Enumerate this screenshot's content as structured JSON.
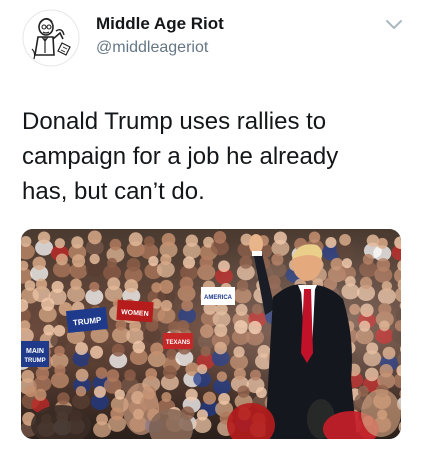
{
  "account": {
    "display_name": "Middle Age Riot",
    "handle": "@middleageriot"
  },
  "tweet": {
    "text_lines": [
      "Donald Trump uses rallies to",
      "campaign for a job he already",
      "has, but can’t do."
    ]
  },
  "media": {
    "signs": [
      "TRUMP",
      "WOMEN",
      "MAIN",
      "TRUMP",
      "TEXANS",
      "AMERICA"
    ]
  },
  "colors": {
    "text": "#14171a",
    "secondary": "#657786",
    "caret": "#aab8c2"
  }
}
